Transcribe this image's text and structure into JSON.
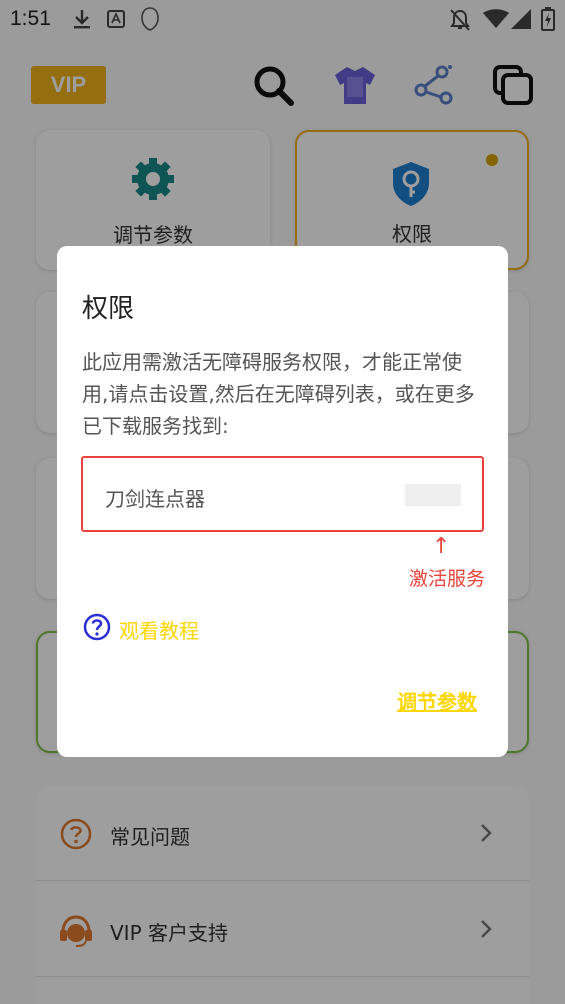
{
  "status_bar": {
    "time": "1:51",
    "icons": [
      "download-icon",
      "text-recognition-icon",
      "shield-app-icon",
      "notifications-off-icon",
      "wifi-icon",
      "signal-icon",
      "battery-icon"
    ]
  },
  "toolbar": {
    "vip_label": "VIP",
    "icons": [
      "search-icon",
      "theme-shirt-icon",
      "share-icon",
      "multi-window-icon"
    ]
  },
  "cards": {
    "adjust_params": "调节参数",
    "permissions": "权限"
  },
  "menu": {
    "items": [
      {
        "label": "常见问题",
        "icon": "question-circle-icon"
      },
      {
        "label": "VIP 客户支持",
        "icon": "support-headset-icon"
      }
    ]
  },
  "dialog": {
    "title": "权限",
    "message": "此应用需激活无障碍服务权限，才能正常使用,请点击设置,然后在无障碍列表，或在更多已下载服务找到:",
    "service_name": "刀剑连点器",
    "arrow": "↑",
    "activate_label": "激活服务",
    "tutorial_label": "观看教程",
    "adjust_link": "调节参数"
  },
  "colors": {
    "vip": "#f0b21c",
    "alert_red": "#e8443a",
    "highlight_yellow": "#ffd600",
    "tutorial_blue": "#2b2fd6",
    "accent_teal": "#1b8a8a",
    "menu_orange": "#e07a2e"
  }
}
